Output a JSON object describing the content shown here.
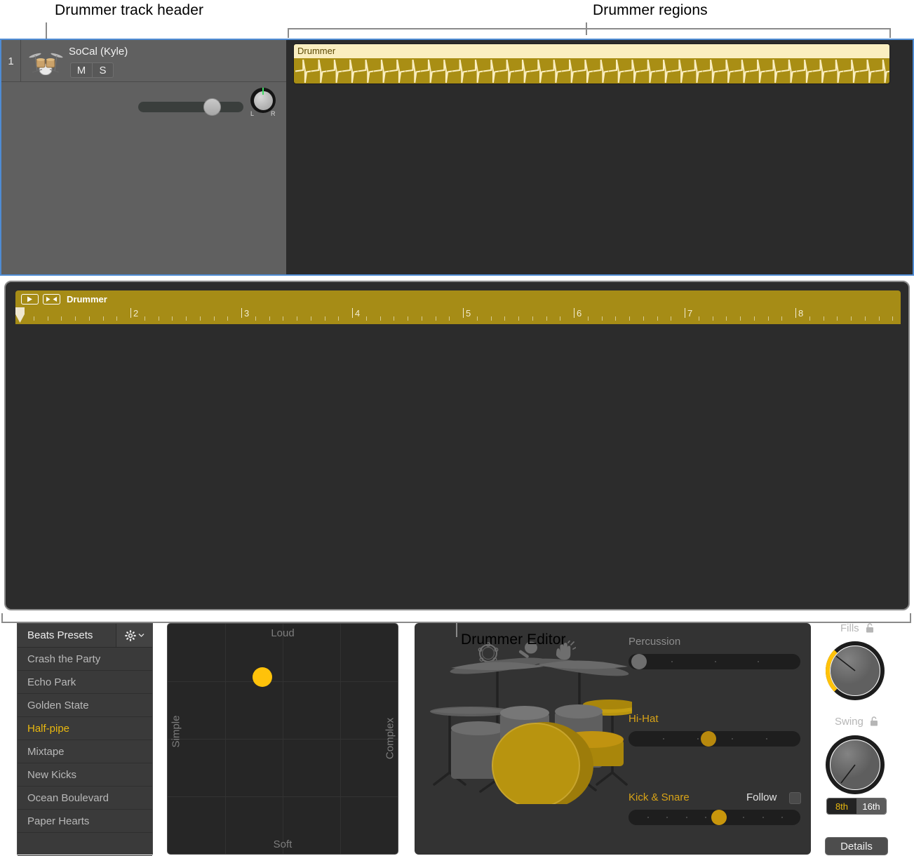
{
  "callouts": {
    "track_header": "Drummer track header",
    "regions": "Drummer regions",
    "editor": "Drummer Editor"
  },
  "track": {
    "number": "1",
    "name": "SoCal (Kyle)",
    "mute_label": "M",
    "solo_label": "S",
    "pan_left": "L",
    "pan_right": "R",
    "volume_percent": 73,
    "pan_value": 0,
    "icon": "drum-kit-icon"
  },
  "region": {
    "name": "Drummer",
    "fill_color": "#a98e14",
    "title_color": "#faeec0"
  },
  "editor": {
    "ruler": {
      "label": "Drummer",
      "play_icon": "play-icon",
      "catch_icon": "catch-playhead-icon",
      "bars": [
        "2",
        "3",
        "4",
        "5",
        "6",
        "7",
        "8"
      ],
      "accent_color": "#a68c16"
    },
    "presets": {
      "title": "Beats Presets",
      "gear_icon": "gear-icon",
      "chevron_icon": "chevron-down-icon",
      "items": [
        "Crash the Party",
        "Echo Park",
        "Golden State",
        "Half-pipe",
        "Mixtape",
        "New Kicks",
        "Ocean Boulevard",
        "Paper Hearts"
      ],
      "selected": "Half-pipe",
      "selected_color": "#e9b80f"
    },
    "xy_pad": {
      "top_label": "Loud",
      "bottom_label": "Soft",
      "left_label": "Simple",
      "right_label": "Complex",
      "puck_x_percent": 41,
      "puck_y_percent": 23,
      "puck_color": "#ffc20a"
    },
    "kit": {
      "percussion_icons": [
        "tambourine-icon",
        "shaker-icon",
        "clap-icon"
      ],
      "highlight_color": "#b8940f",
      "kit_icon": "drum-kit-illustration"
    },
    "sliders": [
      {
        "label": "Percussion",
        "value_percent": 2,
        "active": false,
        "thumb_color": "#6e6e6e",
        "ticks": 3
      },
      {
        "label": "Hi-Hat",
        "value_percent": 46,
        "active": true,
        "thumb_color": "#b8890d",
        "ticks": 4
      },
      {
        "label": "Kick & Snare",
        "value_percent": 53,
        "active": true,
        "thumb_color": "#c8960c",
        "ticks": 8
      }
    ],
    "follow": {
      "label": "Follow",
      "checked": false
    },
    "knobs": [
      {
        "label": "Fills",
        "lock_icon": "lock-open-icon",
        "value_percent": 30,
        "arc": true
      },
      {
        "label": "Swing",
        "lock_icon": "lock-open-icon",
        "value_percent": 8,
        "arc": false
      }
    ],
    "note_division": {
      "options": [
        "8th",
        "16th"
      ],
      "selected": "8th"
    },
    "details_button": "Details"
  }
}
